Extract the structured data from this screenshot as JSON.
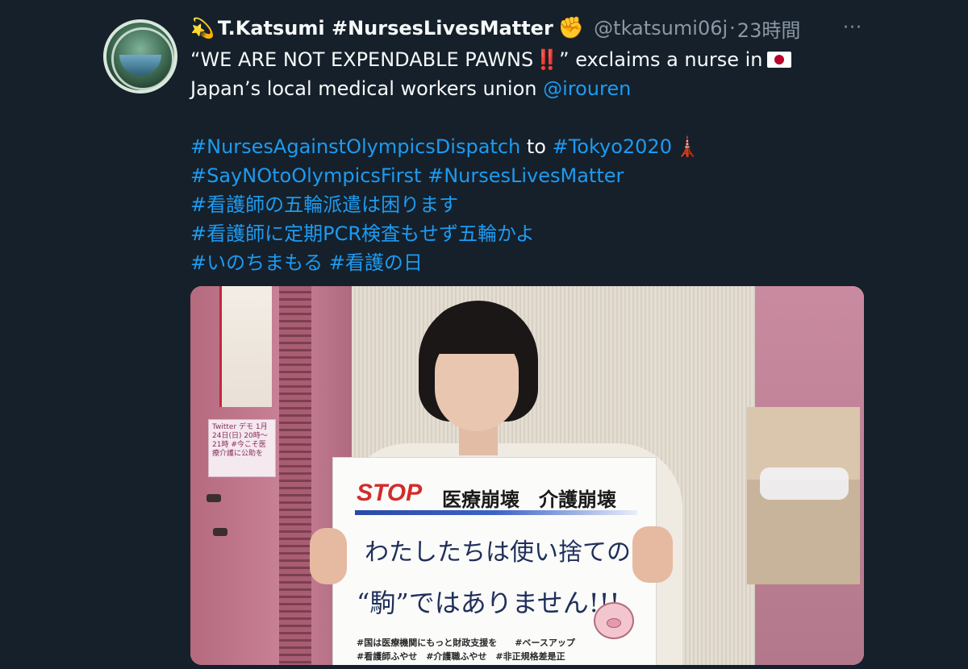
{
  "tweet": {
    "name_emoji": "💫",
    "display_name": "T.Katsumi #NursesLivesMatter",
    "name_suffix_emoji": "✊",
    "handle": "@tkatsumi06j",
    "separator": "·",
    "time": "23時間",
    "more": "···",
    "text": {
      "l1_a": "“WE ARE NOT EXPENDABLE PAWNS",
      "l1_bang": "‼️",
      "l1_b": "” exclaims a nurse in",
      "l2_a": "Japan’s local medical workers union ",
      "l2_mention": "@irouren",
      "l3_tag1": "#NursesAgainstOlympicsDispatch",
      "l3_to": " to ",
      "l3_tag2": "#Tokyo2020",
      "l3_emoji": "🗼",
      "l4_tag1": "#SayNOtoOlympicsFirst",
      "l4_tag2": "#NursesLivesMatter",
      "l5": "#看護師の五輪派遣は困ります",
      "l6": "#看護師に定期PCR検査もせず五輪かよ",
      "l7_tag1": "#いのちまもる",
      "l7_tag2": "#看護の日"
    }
  },
  "media": {
    "sign_stop": "STOP",
    "sign_header": "医療崩壊　介護崩壊",
    "sign_line1": "わたしたちは使い捨ての",
    "sign_line2": "“駒”ではありません!!!",
    "sign_footer1": "#国は医療機関にもっと財政支援を　　#ベースアップ",
    "sign_footer2": "#看護師ふやせ　#介護職ふやせ　#非正規格差是正",
    "poster_twitter": "Twitter デモ 1月24日(日) 20時〜21時 #今こそ医療介護に公助を"
  },
  "colors": {
    "background": "#15202b",
    "link": "#1d9bf0",
    "secondary_text": "#8b98a5"
  }
}
